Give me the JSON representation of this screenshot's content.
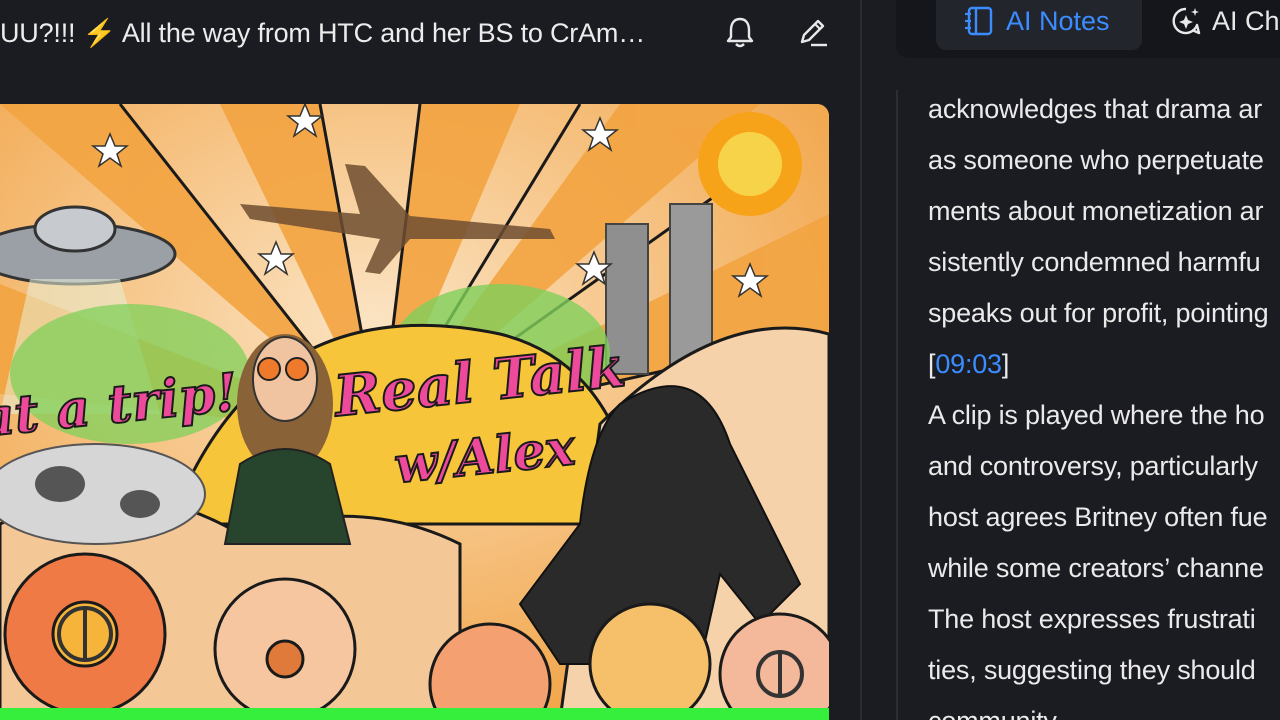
{
  "header": {
    "video_title": "UU?!!! ⚡ All the way from HTC and her BS to CrAm…"
  },
  "icons": {
    "bell": "bell-icon",
    "edit": "edit-pencil-icon",
    "notes": "notes-icon",
    "chat": "chat-sparkle-icon"
  },
  "thumbnail": {
    "text_left": "at a trip!",
    "title_line1": "Real Talk",
    "title_line2": "w/Alex",
    "bottom_strip_color": "#36ef3c"
  },
  "tabs": {
    "notes_label": "AI Notes",
    "chat_label": "AI Chat"
  },
  "notes": {
    "line1": "acknowledges that drama ar",
    "line2": "as someone who perpetuate",
    "line3": "ments about monetization ar",
    "line4": "sistently condemned harmfu",
    "line5_prefix": "speaks out for profit, pointing",
    "timestamp_open": "[",
    "timestamp": "09:03",
    "timestamp_close": "]",
    "line6": "A clip is played where the ho",
    "line7": "and controversy, particularly",
    "line8": "host agrees Britney often fue",
    "line9": "while some creators’ channe",
    "line10": "The host expresses frustrati",
    "line11": "ties, suggesting they should",
    "line12": "community"
  },
  "colors": {
    "accent": "#3b8cff",
    "background": "#1b1c22",
    "text": "#eaeaea"
  }
}
